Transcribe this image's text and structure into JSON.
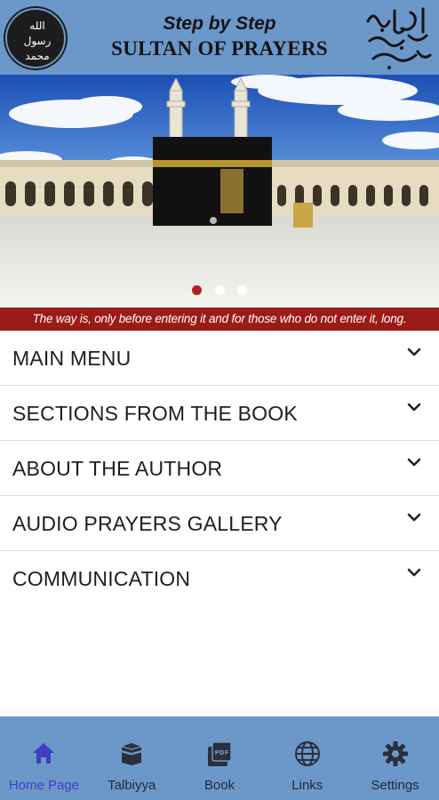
{
  "header": {
    "seal_text": [
      "الله",
      "رسول",
      "محمد"
    ],
    "subtitle": "Step by Step",
    "title": "SULTAN OF PRAYERS",
    "calligraphy_icon": "salawat-calligraphy"
  },
  "banner": {
    "image": "kaaba-masjid-al-haram",
    "slides": 3,
    "active_slide": 0
  },
  "tagline": "The way is, only before entering it and for those who do not enter it, long.",
  "menu": [
    {
      "label": "MAIN MENU"
    },
    {
      "label": "SECTIONS FROM THE BOOK"
    },
    {
      "label": "ABOUT THE AUTHOR"
    },
    {
      "label": "AUDIO PRAYERS GALLERY"
    },
    {
      "label": "COMMUNICATION"
    }
  ],
  "bottom_nav": [
    {
      "label": "Home Page",
      "icon": "home-icon",
      "active": true
    },
    {
      "label": "Talbiyya",
      "icon": "kaaba-icon",
      "active": false
    },
    {
      "label": "Book",
      "icon": "pdf-icon",
      "active": false
    },
    {
      "label": "Links",
      "icon": "globe-icon",
      "active": false
    },
    {
      "label": "Settings",
      "icon": "gear-icon",
      "active": false
    }
  ],
  "colors": {
    "header_bg": "#6c97c9",
    "tagline_bg": "#9b1b17",
    "active_nav": "#3f3fc4",
    "active_dot": "#b22222"
  }
}
